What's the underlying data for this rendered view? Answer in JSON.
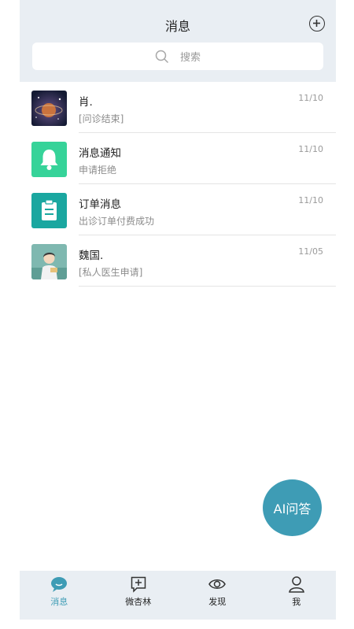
{
  "header": {
    "title": "消息",
    "add_icon": "plus-circle-icon",
    "search_placeholder": "搜索"
  },
  "messages": [
    {
      "name": "肖.",
      "time": "11/10",
      "preview": "[问诊结束]",
      "avatar": "galaxy-photo"
    },
    {
      "name": "消息通知",
      "time": "11/10",
      "preview": "申请拒绝",
      "avatar": "bell-icon"
    },
    {
      "name": "订单消息",
      "time": "11/10",
      "preview": "出诊订单付费成功",
      "avatar": "clipboard-icon"
    },
    {
      "name": "魏国.",
      "time": "11/05",
      "preview": "[私人医生申请]",
      "avatar": "illustrated-person-photo"
    }
  ],
  "ai_button": {
    "label": "AI问答"
  },
  "tabs": [
    {
      "label": "消息",
      "icon": "chat-bubble-icon",
      "active": true
    },
    {
      "label": "微杏林",
      "icon": "chat-plus-icon",
      "active": false
    },
    {
      "label": "发现",
      "icon": "eye-icon",
      "active": false
    },
    {
      "label": "我",
      "icon": "person-icon",
      "active": false
    }
  ],
  "colors": {
    "accent": "#3e9cb5",
    "header_bg": "#e9eef3",
    "notify_green": "#36d399",
    "order_teal": "#1aa7a0"
  }
}
